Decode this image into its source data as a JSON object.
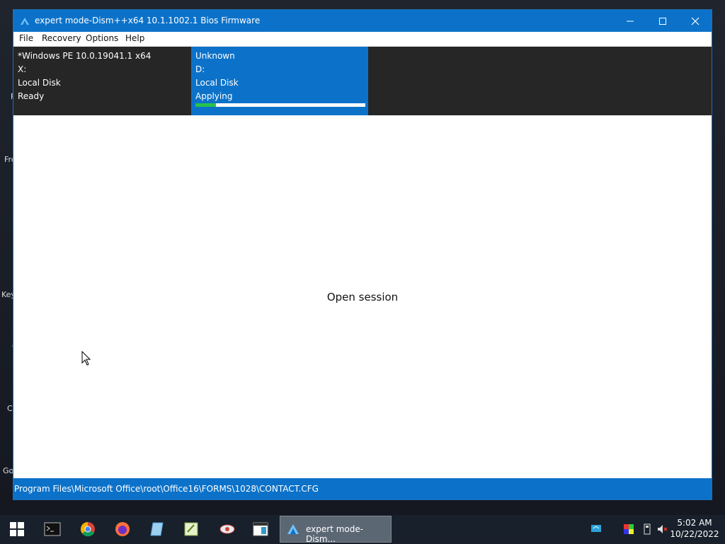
{
  "window": {
    "title": "expert mode-Dism++x64 10.1.1002.1 Bios Firmware"
  },
  "menu": [
    "File",
    "Recovery",
    "Options",
    "Help"
  ],
  "sessions": [
    {
      "name": "*Windows PE 10.0.19041.1 x64",
      "drive": "X:",
      "type": "Local Disk",
      "status": "Ready"
    },
    {
      "name": "Unknown",
      "drive": "D:",
      "type": "Local Disk",
      "status": "Applying",
      "progress_percent": 12
    }
  ],
  "content": {
    "message": "Open session"
  },
  "statusbar": {
    "text": "Program Files\\Microsoft Office\\root\\Office16\\FORMS\\1028\\CONTACT.CFG"
  },
  "desktop_fragments": [
    "F",
    "Fre",
    "Key",
    "C",
    "C",
    "Go"
  ],
  "taskbar": {
    "active_app_label": "expert mode-Dism..."
  },
  "clock": {
    "time": "5:02 AM",
    "date": "10/22/2022"
  },
  "colors": {
    "accent": "#0c72c9",
    "progress": "#27c24c",
    "dark_panel": "#262626"
  }
}
